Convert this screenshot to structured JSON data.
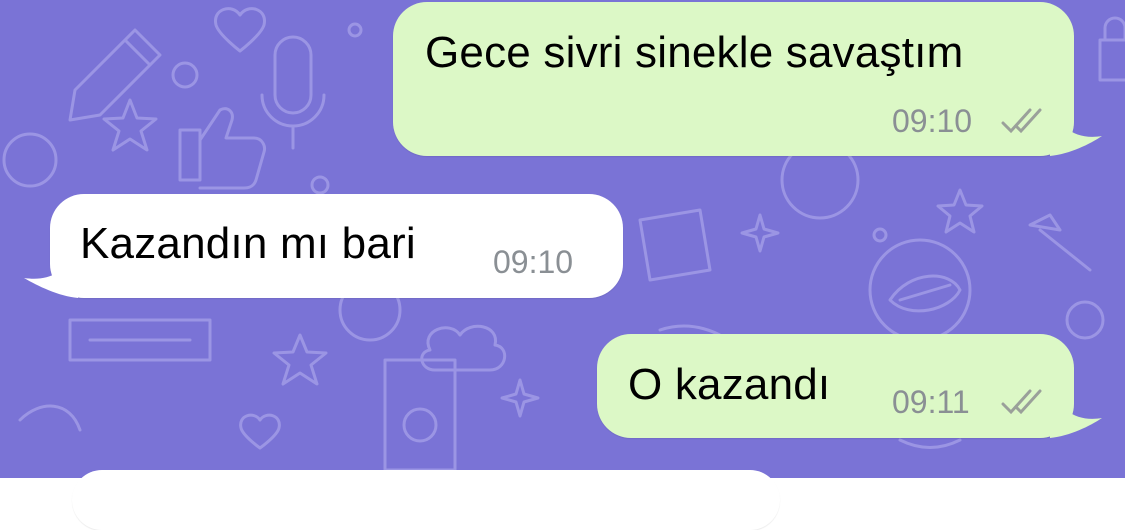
{
  "conversation": {
    "messages": [
      {
        "direction": "outgoing",
        "text": "Gece sivri sinekle savaştım",
        "time": "09:10",
        "status": "read-double-check"
      },
      {
        "direction": "incoming",
        "text": "Kazandın mı bari",
        "time": "09:10"
      },
      {
        "direction": "outgoing",
        "text": "O kazandı",
        "time": "09:11",
        "status": "read-double-check"
      }
    ]
  },
  "colors": {
    "wallpaper": "#7a73d6",
    "outgoing_bubble": "#dcf8c6",
    "incoming_bubble": "#ffffff",
    "timestamp": "#8a8f94"
  },
  "icons": [
    "double-check-icon"
  ]
}
